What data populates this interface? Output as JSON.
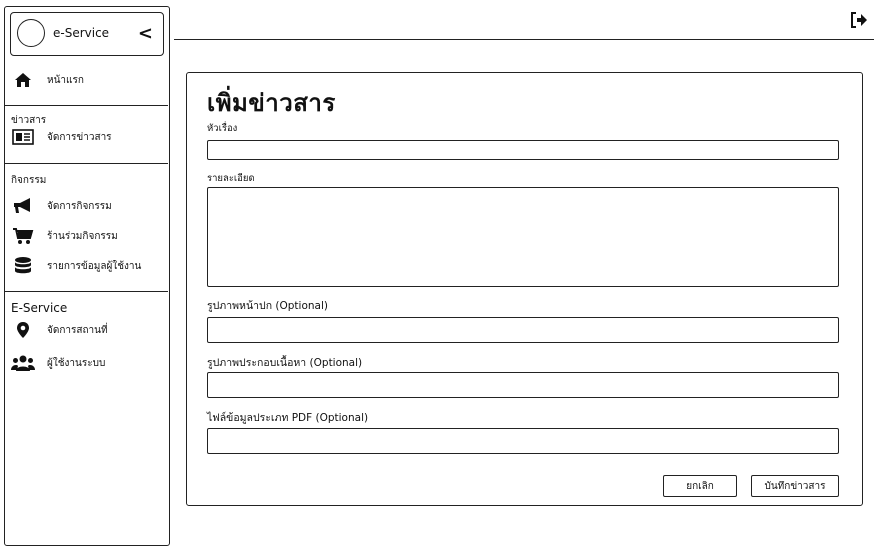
{
  "sidebar": {
    "brand_title": "e-Service",
    "collapse_symbol": "<",
    "home_label": "หน้าแรก",
    "sections": {
      "news": {
        "title": "ข่าวสาร",
        "items": [
          "จัดการข่าวสาร"
        ]
      },
      "activity": {
        "title": "กิจกรรม",
        "items": [
          "จัดการกิจกรรม",
          "ร้านร่วมกิจกรรม",
          "รายการข้อมูลผู้ใช้งาน"
        ]
      },
      "eservice": {
        "title": "E-Service",
        "items": [
          "จัดการสถานที่",
          "ผู้ใช้งานระบบ"
        ]
      }
    },
    "icons": [
      "home-icon",
      "newspaper-icon",
      "megaphone-icon",
      "cart-icon",
      "database-icon",
      "map-pin-icon",
      "users-icon"
    ]
  },
  "topbar": {
    "logout_icon": "sign-out-icon"
  },
  "form": {
    "heading": "เพิ่มข่าวสาร",
    "fields": [
      {
        "label": "หัวเรื่อง",
        "value": ""
      },
      {
        "label": "รายละเอียด",
        "value": ""
      },
      {
        "label": "รูปภาพหน้าปก (Optional)",
        "value": ""
      },
      {
        "label": "รูปภาพประกอบเนื้อหา (Optional)",
        "value": ""
      },
      {
        "label": "ไฟล์ข้อมูลประเภท PDF (Optional)",
        "value": ""
      }
    ],
    "cancel_label": "ยกเลิก",
    "save_label": "บันทึกข่าวสาร"
  }
}
